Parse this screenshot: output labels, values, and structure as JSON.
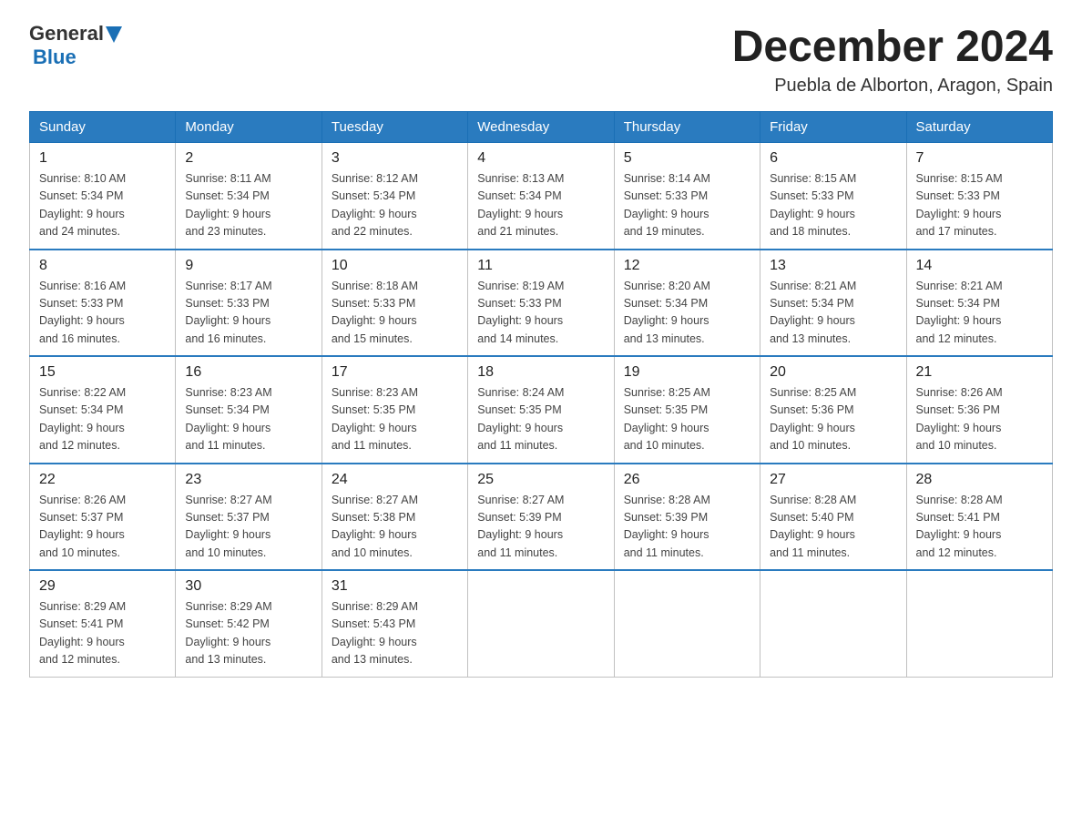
{
  "header": {
    "logo_general": "General",
    "logo_blue": "Blue",
    "title": "December 2024",
    "subtitle": "Puebla de Alborton, Aragon, Spain"
  },
  "days_of_week": [
    "Sunday",
    "Monday",
    "Tuesday",
    "Wednesday",
    "Thursday",
    "Friday",
    "Saturday"
  ],
  "weeks": [
    [
      {
        "num": "1",
        "sunrise": "8:10 AM",
        "sunset": "5:34 PM",
        "daylight": "9 hours and 24 minutes."
      },
      {
        "num": "2",
        "sunrise": "8:11 AM",
        "sunset": "5:34 PM",
        "daylight": "9 hours and 23 minutes."
      },
      {
        "num": "3",
        "sunrise": "8:12 AM",
        "sunset": "5:34 PM",
        "daylight": "9 hours and 22 minutes."
      },
      {
        "num": "4",
        "sunrise": "8:13 AM",
        "sunset": "5:34 PM",
        "daylight": "9 hours and 21 minutes."
      },
      {
        "num": "5",
        "sunrise": "8:14 AM",
        "sunset": "5:33 PM",
        "daylight": "9 hours and 19 minutes."
      },
      {
        "num": "6",
        "sunrise": "8:15 AM",
        "sunset": "5:33 PM",
        "daylight": "9 hours and 18 minutes."
      },
      {
        "num": "7",
        "sunrise": "8:15 AM",
        "sunset": "5:33 PM",
        "daylight": "9 hours and 17 minutes."
      }
    ],
    [
      {
        "num": "8",
        "sunrise": "8:16 AM",
        "sunset": "5:33 PM",
        "daylight": "9 hours and 16 minutes."
      },
      {
        "num": "9",
        "sunrise": "8:17 AM",
        "sunset": "5:33 PM",
        "daylight": "9 hours and 16 minutes."
      },
      {
        "num": "10",
        "sunrise": "8:18 AM",
        "sunset": "5:33 PM",
        "daylight": "9 hours and 15 minutes."
      },
      {
        "num": "11",
        "sunrise": "8:19 AM",
        "sunset": "5:33 PM",
        "daylight": "9 hours and 14 minutes."
      },
      {
        "num": "12",
        "sunrise": "8:20 AM",
        "sunset": "5:34 PM",
        "daylight": "9 hours and 13 minutes."
      },
      {
        "num": "13",
        "sunrise": "8:21 AM",
        "sunset": "5:34 PM",
        "daylight": "9 hours and 13 minutes."
      },
      {
        "num": "14",
        "sunrise": "8:21 AM",
        "sunset": "5:34 PM",
        "daylight": "9 hours and 12 minutes."
      }
    ],
    [
      {
        "num": "15",
        "sunrise": "8:22 AM",
        "sunset": "5:34 PM",
        "daylight": "9 hours and 12 minutes."
      },
      {
        "num": "16",
        "sunrise": "8:23 AM",
        "sunset": "5:34 PM",
        "daylight": "9 hours and 11 minutes."
      },
      {
        "num": "17",
        "sunrise": "8:23 AM",
        "sunset": "5:35 PM",
        "daylight": "9 hours and 11 minutes."
      },
      {
        "num": "18",
        "sunrise": "8:24 AM",
        "sunset": "5:35 PM",
        "daylight": "9 hours and 11 minutes."
      },
      {
        "num": "19",
        "sunrise": "8:25 AM",
        "sunset": "5:35 PM",
        "daylight": "9 hours and 10 minutes."
      },
      {
        "num": "20",
        "sunrise": "8:25 AM",
        "sunset": "5:36 PM",
        "daylight": "9 hours and 10 minutes."
      },
      {
        "num": "21",
        "sunrise": "8:26 AM",
        "sunset": "5:36 PM",
        "daylight": "9 hours and 10 minutes."
      }
    ],
    [
      {
        "num": "22",
        "sunrise": "8:26 AM",
        "sunset": "5:37 PM",
        "daylight": "9 hours and 10 minutes."
      },
      {
        "num": "23",
        "sunrise": "8:27 AM",
        "sunset": "5:37 PM",
        "daylight": "9 hours and 10 minutes."
      },
      {
        "num": "24",
        "sunrise": "8:27 AM",
        "sunset": "5:38 PM",
        "daylight": "9 hours and 10 minutes."
      },
      {
        "num": "25",
        "sunrise": "8:27 AM",
        "sunset": "5:39 PM",
        "daylight": "9 hours and 11 minutes."
      },
      {
        "num": "26",
        "sunrise": "8:28 AM",
        "sunset": "5:39 PM",
        "daylight": "9 hours and 11 minutes."
      },
      {
        "num": "27",
        "sunrise": "8:28 AM",
        "sunset": "5:40 PM",
        "daylight": "9 hours and 11 minutes."
      },
      {
        "num": "28",
        "sunrise": "8:28 AM",
        "sunset": "5:41 PM",
        "daylight": "9 hours and 12 minutes."
      }
    ],
    [
      {
        "num": "29",
        "sunrise": "8:29 AM",
        "sunset": "5:41 PM",
        "daylight": "9 hours and 12 minutes."
      },
      {
        "num": "30",
        "sunrise": "8:29 AM",
        "sunset": "5:42 PM",
        "daylight": "9 hours and 13 minutes."
      },
      {
        "num": "31",
        "sunrise": "8:29 AM",
        "sunset": "5:43 PM",
        "daylight": "9 hours and 13 minutes."
      },
      null,
      null,
      null,
      null
    ]
  ],
  "labels": {
    "sunrise_prefix": "Sunrise: ",
    "sunset_prefix": "Sunset: ",
    "daylight_prefix": "Daylight: "
  }
}
